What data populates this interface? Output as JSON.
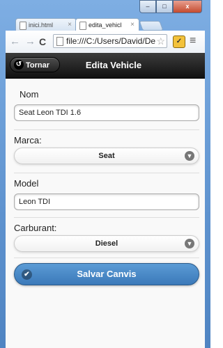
{
  "browser": {
    "tabs": [
      {
        "label": "inici.html"
      },
      {
        "label": "edita_vehicl"
      }
    ],
    "address": "file:///C:/Users/David/De",
    "window_buttons": {
      "minimize": "–",
      "maximize": "□",
      "close": "x"
    }
  },
  "header": {
    "back_label": "Tornar",
    "title": "Edita Vehicle"
  },
  "form": {
    "nom_label": "Nom",
    "nom_value": "Seat Leon TDI 1.6",
    "marca_label": "Marca:",
    "marca_value": "Seat",
    "model_label": "Model",
    "model_value": "Leon TDI",
    "carburant_label": "Carburant:",
    "carburant_value": "Diesel",
    "save_label": "Salvar Canvis"
  },
  "colors": {
    "header": "#111111",
    "save_button": "#4a8ac8"
  }
}
